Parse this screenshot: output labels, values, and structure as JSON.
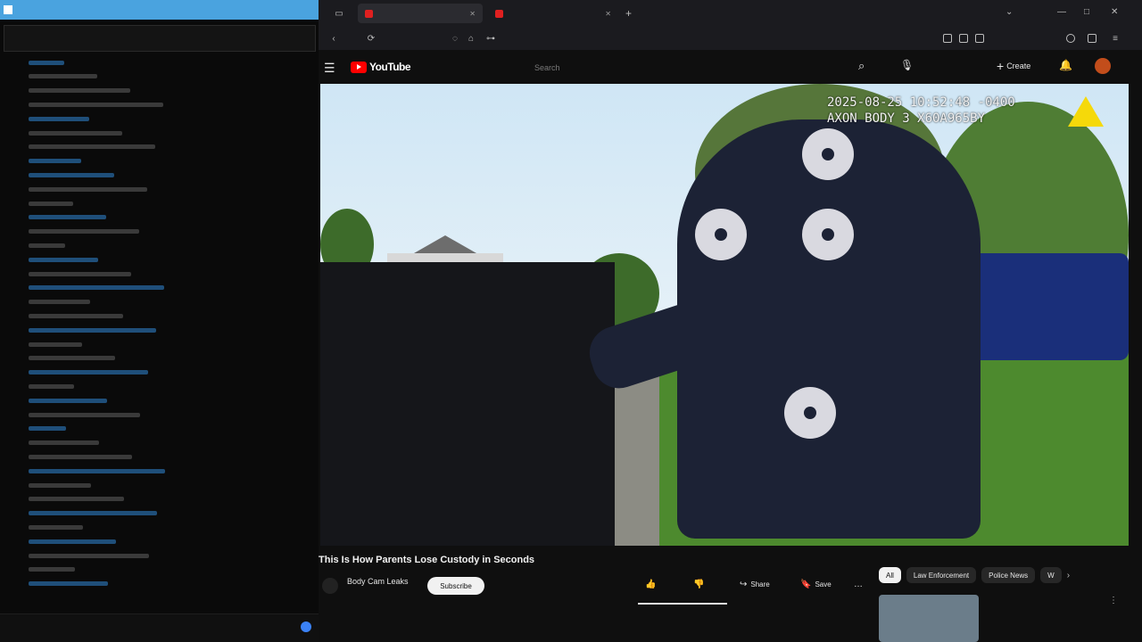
{
  "chat": {
    "pinned": "",
    "messages": [
      {
        "user": "",
        "color": "#3aa0ff"
      },
      {
        "user": "",
        "color": "#ffffff"
      },
      {
        "user": "",
        "color": "#ffffff"
      },
      {
        "user": "",
        "color": "#ffffff"
      },
      {
        "user": "",
        "color": "#3aa0ff"
      },
      {
        "user": "",
        "color": "#ffffff"
      },
      {
        "user": "",
        "color": "#ffffff"
      },
      {
        "user": "",
        "color": "#3aa0ff"
      },
      {
        "user": "",
        "color": "#3aa0ff"
      },
      {
        "user": "",
        "color": "#ffffff"
      },
      {
        "user": "",
        "color": "#ffffff"
      },
      {
        "user": "",
        "color": "#3aa0ff"
      },
      {
        "user": "",
        "color": "#ffffff"
      },
      {
        "user": "",
        "color": "#ffffff"
      },
      {
        "user": "",
        "color": "#3aa0ff"
      },
      {
        "user": "",
        "color": "#ffffff"
      },
      {
        "user": "",
        "color": "#3aa0ff"
      },
      {
        "user": "",
        "color": "#ffffff"
      },
      {
        "user": "",
        "color": "#ffffff"
      },
      {
        "user": "",
        "color": "#3aa0ff"
      },
      {
        "user": "",
        "color": "#ffffff"
      },
      {
        "user": "",
        "color": "#ffffff"
      },
      {
        "user": "",
        "color": "#3aa0ff"
      },
      {
        "user": "",
        "color": "#ffffff"
      },
      {
        "user": "",
        "color": "#3aa0ff"
      },
      {
        "user": "",
        "color": "#ffffff"
      },
      {
        "user": "",
        "color": "#3aa0ff"
      },
      {
        "user": "",
        "color": "#ffffff"
      },
      {
        "user": "",
        "color": "#ffffff"
      },
      {
        "user": "",
        "color": "#3aa0ff"
      },
      {
        "user": "",
        "color": "#ffffff"
      },
      {
        "user": "",
        "color": "#ffffff"
      },
      {
        "user": "",
        "color": "#3aa0ff"
      },
      {
        "user": "",
        "color": "#ffffff"
      },
      {
        "user": "",
        "color": "#3aa0ff"
      },
      {
        "user": "",
        "color": "#ffffff"
      },
      {
        "user": "",
        "color": "#ffffff"
      },
      {
        "user": "",
        "color": "#3aa0ff"
      }
    ]
  },
  "browser": {
    "tabs": [
      {
        "label": "",
        "active": true
      },
      {
        "label": "",
        "active": false
      }
    ],
    "url": ""
  },
  "youtube": {
    "logo": "YouTube",
    "search_placeholder": "Search",
    "create_label": "Create",
    "icons": {
      "menu": "hamburger-icon",
      "search": "search-icon",
      "mic": "mic-icon",
      "bell": "bell-icon"
    }
  },
  "video": {
    "timestamp_line1": "2025-08-25 10:52:48 -0400",
    "timestamp_line2": "AXON BODY 3 X60A965BY",
    "title": "This Is How Parents Lose Custody in Seconds",
    "channel": "Body Cam Leaks",
    "subscribe": "Subscribe",
    "actions": {
      "like": "",
      "dislike": "",
      "share": "Share",
      "save": "Save"
    },
    "description_meta": "",
    "description": ""
  },
  "sidebar": {
    "chips": [
      "All",
      "Law Enforcement",
      "Police News",
      "W"
    ],
    "active_chip": "All",
    "recommendation": {
      "title": "",
      "meta": ""
    }
  },
  "colors": {
    "youtube_red": "#ff0000",
    "chat_titlebar": "#4aa3df",
    "subscribe_bg": "#f1f1f1"
  }
}
